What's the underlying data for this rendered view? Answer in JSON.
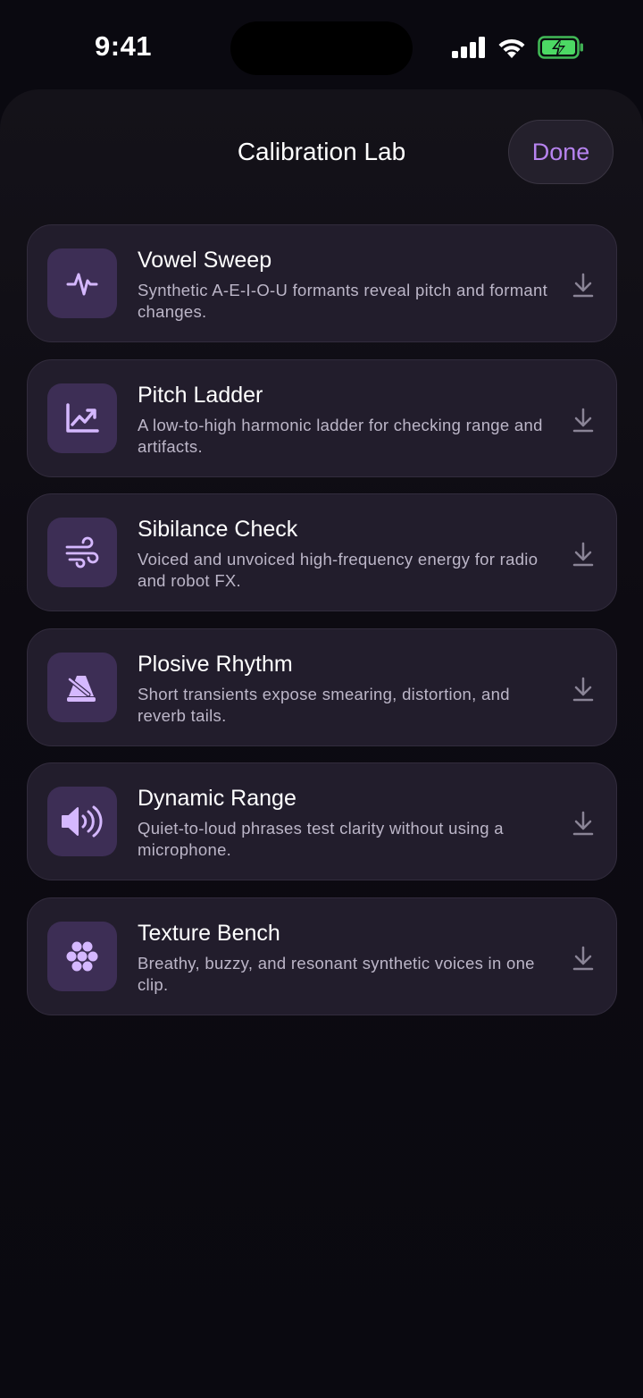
{
  "status_bar": {
    "time": "9:41"
  },
  "header": {
    "title": "Calibration Lab",
    "done_label": "Done"
  },
  "colors": {
    "accent": "#b783f0",
    "card_bg": "#221d2c",
    "icon_tile": "#3d2e55",
    "battery": "#4cd964"
  },
  "items": [
    {
      "title": "Vowel Sweep",
      "description": "Synthetic A-E-I-O-U formants reveal pitch and formant changes.",
      "icon": "waveform-pulse-icon"
    },
    {
      "title": "Pitch Ladder",
      "description": "A low-to-high harmonic ladder for checking range and artifacts.",
      "icon": "trend-chart-icon"
    },
    {
      "title": "Sibilance Check",
      "description": "Voiced and unvoiced high-frequency energy for radio and robot FX.",
      "icon": "wind-icon"
    },
    {
      "title": "Plosive Rhythm",
      "description": "Short transients expose smearing, distortion, and reverb tails.",
      "icon": "metronome-icon"
    },
    {
      "title": "Dynamic Range",
      "description": "Quiet-to-loud phrases test clarity without using a microphone.",
      "icon": "speaker-wave-icon"
    },
    {
      "title": "Texture Bench",
      "description": "Breathy, buzzy, and resonant synthetic voices in one clip.",
      "icon": "dots-cluster-icon"
    }
  ]
}
